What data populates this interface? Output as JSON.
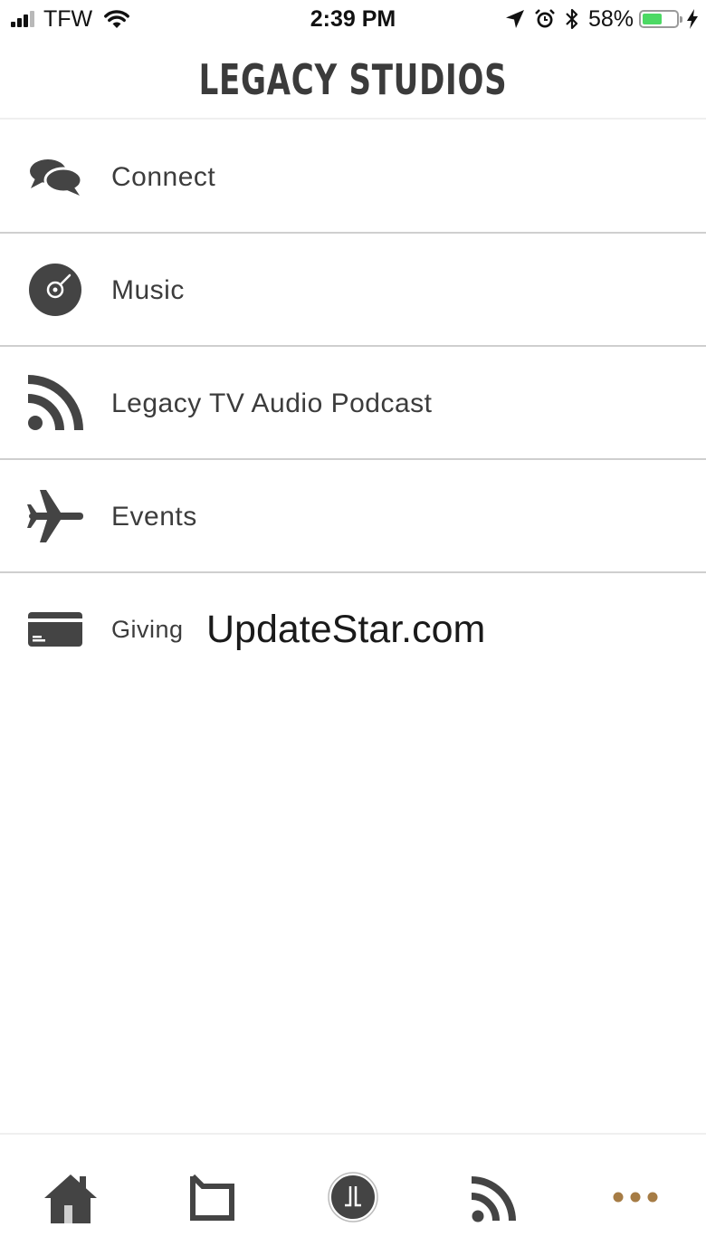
{
  "status_bar": {
    "carrier": "TFW",
    "time": "2:39 PM",
    "battery_percent": "58%",
    "battery_level": 0.58,
    "signal_bars_filled": 3,
    "icons": [
      "wifi-icon",
      "location-arrow-icon",
      "alarm-icon",
      "bluetooth-icon",
      "charging-bolt-icon"
    ]
  },
  "header": {
    "logo_text": "LEGACY STUDIOS"
  },
  "menu": {
    "items": [
      {
        "label": "Connect",
        "icon": "chat-bubbles-icon"
      },
      {
        "label": "Music",
        "icon": "vinyl-record-icon"
      },
      {
        "label": "Legacy TV Audio Podcast",
        "icon": "rss-feed-icon"
      },
      {
        "label": "Events",
        "icon": "airplane-icon"
      },
      {
        "label": "Giving",
        "icon": "credit-card-icon"
      }
    ],
    "watermark": "UpdateStar.com"
  },
  "tab_bar": {
    "tabs": [
      {
        "icon": "home-icon"
      },
      {
        "icon": "crop-frame-icon"
      },
      {
        "icon": "legacy-logo-icon"
      },
      {
        "icon": "rss-feed-icon"
      },
      {
        "icon": "more-dots-icon"
      }
    ],
    "active_color": "#a67c45",
    "icon_color": "#3f3f3f"
  }
}
